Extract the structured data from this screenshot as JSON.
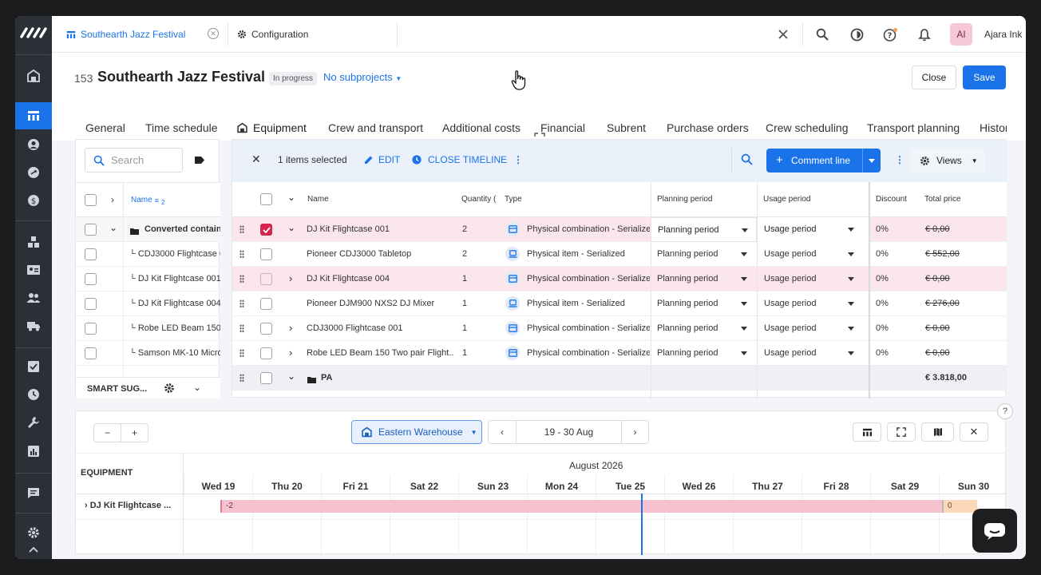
{
  "topbar": {
    "active_tab": "Southearth Jazz Festival",
    "second_tab": "Configuration",
    "user_initials": "AI",
    "user_name": "Ajara Ink"
  },
  "project": {
    "number": "153",
    "title": "Southearth Jazz Festival",
    "status": "In progress",
    "subprojects": "No subprojects",
    "close_label": "Close",
    "save_label": "Save"
  },
  "tabs": [
    "General",
    "Time schedule",
    "Equipment",
    "Crew and transport",
    "Additional costs",
    "Financial",
    "Subrent",
    "Purchase orders",
    "Crew scheduling",
    "Transport planning",
    "Histor"
  ],
  "left_panel": {
    "search_placeholder": "Search",
    "column_name": "Name",
    "sort_badge": "2",
    "rows": [
      "Converted containe",
      "CDJ3000 Flightcase 00",
      "DJ Kit Flightcase 001",
      "DJ Kit Flightcase 004",
      "Robe LED Beam 150 Tw",
      "Samson MK-10 Microp"
    ],
    "footer_label": "SMART SUG..."
  },
  "toolbar": {
    "selected": "1 items selected",
    "edit": "EDIT",
    "close_timeline": "CLOSE TIMELINE",
    "comment_line": "Comment line",
    "views": "Views"
  },
  "grid": {
    "headers": {
      "name": "Name",
      "quantity": "Quantity (",
      "type": "Type",
      "planning": "Planning period",
      "usage": "Usage period",
      "discount": "Discount",
      "total": "Total price"
    },
    "rows": [
      {
        "name": "DJ Kit Flightcase 001",
        "qty": "2",
        "type": "Physical combination - Serialized",
        "planning": "Planning period",
        "usage": "Usage period",
        "discount": "0%",
        "total": "€ 0,00"
      },
      {
        "name": "Pioneer CDJ3000 Tabletop",
        "qty": "2",
        "type": "Physical item - Serialized",
        "planning": "Planning period",
        "usage": "Usage period",
        "discount": "0%",
        "total": "€ 552,00"
      },
      {
        "name": "DJ Kit Flightcase 004",
        "qty": "1",
        "type": "Physical combination - Serialized",
        "planning": "Planning period",
        "usage": "Usage period",
        "discount": "0%",
        "total": "€ 0,00"
      },
      {
        "name": "Pioneer DJM900 NXS2 DJ Mixer",
        "qty": "1",
        "type": "Physical item - Serialized",
        "planning": "Planning period",
        "usage": "Usage period",
        "discount": "0%",
        "total": "€ 276,00"
      },
      {
        "name": "CDJ3000 Flightcase 001",
        "qty": "1",
        "type": "Physical combination - Serialized",
        "planning": "Planning period",
        "usage": "Usage period",
        "discount": "0%",
        "total": "€ 0,00"
      },
      {
        "name": "Robe LED Beam 150 Two pair Flight...",
        "qty": "1",
        "type": "Physical combination - Serialized",
        "planning": "Planning period",
        "usage": "Usage period",
        "discount": "0%",
        "total": "€ 0,00"
      }
    ],
    "group": {
      "name": "PA",
      "total": "€ 3.818,00"
    }
  },
  "timeline": {
    "warehouse": "Eastern Warehouse",
    "date_range": "19 - 30 Aug",
    "section_label": "EQUIPMENT",
    "month": "August 2026",
    "days": [
      "Wed 19",
      "Thu 20",
      "Fri 21",
      "Sat 22",
      "Sun 23",
      "Mon 24",
      "Tue 25",
      "Wed 26",
      "Thu 27",
      "Fri 28",
      "Sat 29",
      "Sun 30"
    ],
    "row_label": "DJ Kit Flightcase ...",
    "bar_value": "-2",
    "bar2_value": "0"
  }
}
